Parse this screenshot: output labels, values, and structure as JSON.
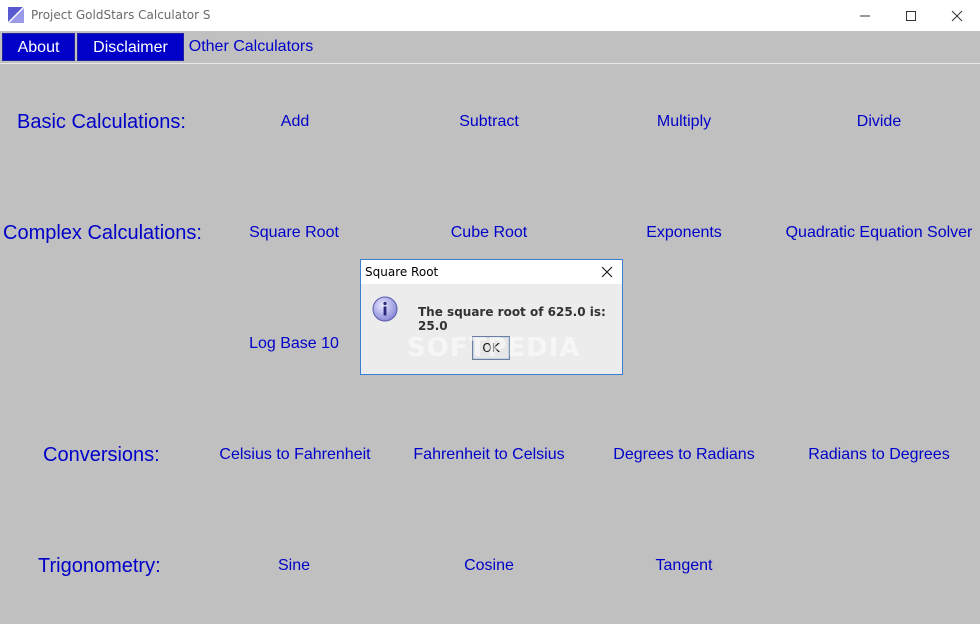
{
  "window": {
    "title": "Project GoldStars Calculator S",
    "minimize_icon": "minimize-icon",
    "maximize_icon": "maximize-icon",
    "close_icon": "close-icon"
  },
  "menu": {
    "about": "About",
    "disclaimer": "Disclaimer",
    "other": "Other Calculators"
  },
  "sections": {
    "basic": {
      "label": "Basic Calculations:",
      "buttons": [
        "Add",
        "Subtract",
        "Multiply",
        "Divide"
      ]
    },
    "complex": {
      "label": "Complex Calculations:",
      "buttons": [
        "Square Root",
        "Cube Root",
        "Exponents",
        "Quadratic Equation Solver",
        "Log Base 10"
      ]
    },
    "conversions": {
      "label": "Conversions:",
      "buttons": [
        "Celsius to Fahrenheit",
        "Fahrenheit to Celsius",
        "Degrees to Radians",
        "Radians to Degrees"
      ]
    },
    "trig": {
      "label": "Trigonometry:",
      "buttons": [
        "Sine",
        "Cosine",
        "Tangent"
      ]
    }
  },
  "dialog": {
    "title": "Square Root",
    "message": "The square root of 625.0 is: 25.0",
    "ok": "OK",
    "icon": "info-icon"
  },
  "watermark": "SOFTPEDIA",
  "colors": {
    "background": "#c0c0c0",
    "accent": "#0000c8",
    "dialog_border": "#3b7fd4"
  }
}
